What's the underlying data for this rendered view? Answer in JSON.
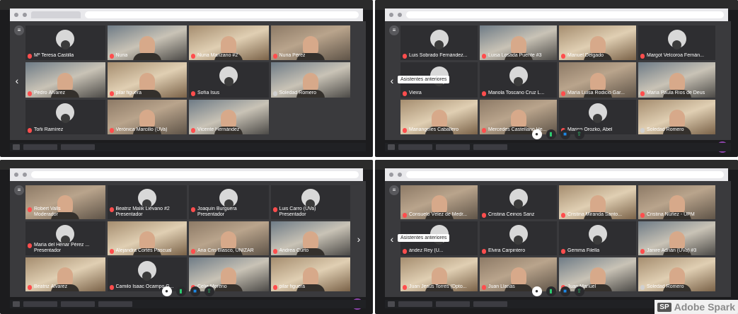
{
  "panels": [
    {
      "tiles": [
        {
          "name": "Mª Teresa Castilla",
          "muted": true,
          "camera": false
        },
        {
          "name": "Nuria",
          "muted": true,
          "camera": true
        },
        {
          "name": "Nuria Manzano #2",
          "muted": true,
          "camera": true
        },
        {
          "name": "Nuria Pérez",
          "muted": true,
          "camera": true
        },
        {
          "name": "Pedro Álvarez",
          "muted": true,
          "camera": true
        },
        {
          "name": "pilar figuera",
          "muted": true,
          "camera": true
        },
        {
          "name": "Sofía Isus",
          "muted": true,
          "camera": false
        },
        {
          "name": "Soledad Romero",
          "muted": false,
          "camera": true
        },
        {
          "name": "Toñi Ramírez",
          "muted": true,
          "camera": false
        },
        {
          "name": "Verónica Marcillo (UVa)",
          "muted": true,
          "camera": true
        },
        {
          "name": "Vicente Hernández",
          "muted": true,
          "camera": true
        }
      ]
    },
    {
      "tooltip": "Asistentes anteriores",
      "tiles": [
        {
          "name": "Luis Sobrado Fernández...",
          "muted": true,
          "camera": false
        },
        {
          "name": "Luisa Losada Puente #3",
          "muted": true,
          "camera": true
        },
        {
          "name": "Manuel Delgado",
          "muted": true,
          "camera": true
        },
        {
          "name": "Margot Velcoroa Fernán...",
          "muted": true,
          "camera": false
        },
        {
          "name": "Vieira",
          "muted": true,
          "camera": false
        },
        {
          "name": "Mariola Toscano Cruz L...",
          "muted": true,
          "camera": false
        },
        {
          "name": "María Luisa Rodicio Gar...",
          "muted": true,
          "camera": true
        },
        {
          "name": "María Paula Ríos de Deus",
          "muted": true,
          "camera": true
        },
        {
          "name": "Mariangeles Caballero",
          "muted": true,
          "camera": true
        },
        {
          "name": "Mercedes Castellano He...",
          "muted": true,
          "camera": true
        },
        {
          "name": "Marino Orozko, Abel",
          "muted": true,
          "camera": false
        },
        {
          "name": "Soledad Romero",
          "muted": false,
          "camera": true
        }
      ]
    },
    {
      "tiles": [
        {
          "name": "Robert Valls",
          "role": "Moderador",
          "muted": true,
          "camera": true
        },
        {
          "name": "Beatriz Malik Liévano #2",
          "role": "Presentador",
          "muted": true,
          "camera": false
        },
        {
          "name": "Joaquín Burguera",
          "role": "Presentador",
          "muted": true,
          "camera": false
        },
        {
          "name": "Luis Carro (UVa)",
          "role": "Presentador",
          "muted": true,
          "camera": false
        },
        {
          "name": "María del Henar Pérez ...",
          "role": "Presentador",
          "muted": true,
          "camera": false
        },
        {
          "name": "Alejandra Cortés Pascual",
          "muted": true,
          "camera": true
        },
        {
          "name": "Ana Cris Blasco, UNIZAR",
          "muted": true,
          "camera": true
        },
        {
          "name": "Andrea Curto",
          "muted": true,
          "camera": true
        },
        {
          "name": "Beatriz Álvarez",
          "muted": true,
          "camera": true
        },
        {
          "name": "Camilo Isaac Ocampo G...",
          "muted": true,
          "camera": false
        },
        {
          "name": "Celia Moreno",
          "muted": true,
          "camera": true
        },
        {
          "name": "pilar figuera",
          "muted": true,
          "camera": true
        }
      ]
    },
    {
      "tooltip": "Asistentes anteriores",
      "tiles": [
        {
          "name": "Consuelo Vélez de Medr...",
          "muted": true,
          "camera": true
        },
        {
          "name": "Cristina Ceinos Sanz",
          "muted": true,
          "camera": false
        },
        {
          "name": "Cristina Miranda Santo...",
          "muted": true,
          "camera": true
        },
        {
          "name": "Cristina Núñez - UPM",
          "muted": true,
          "camera": true
        },
        {
          "name": "ández Rey (U...",
          "muted": true,
          "camera": false
        },
        {
          "name": "Elvira Carpintero",
          "muted": true,
          "camera": false
        },
        {
          "name": "Gemma Filella",
          "muted": true,
          "camera": false
        },
        {
          "name": "Janire Adrián (UVa) #3",
          "muted": true,
          "camera": true
        },
        {
          "name": "Juan Jesús Torres (Dpto...",
          "muted": true,
          "camera": true
        },
        {
          "name": "Juan Llanas",
          "muted": true,
          "camera": true
        },
        {
          "name": "Juan Manuel",
          "muted": true,
          "camera": true
        },
        {
          "name": "Soledad Romero",
          "muted": false,
          "camera": true
        }
      ]
    }
  ],
  "watermark": {
    "badge": "SP",
    "text": "Adobe Spark"
  },
  "icons": {
    "menu": "menu-icon",
    "left_arrow": "chevron-left-icon",
    "right_arrow": "chevron-right-icon",
    "mic": "mic-icon",
    "video": "video-icon",
    "share": "share-screen-icon",
    "user": "user-avatar-icon"
  },
  "colors": {
    "muted_mic": "#ff4d4d",
    "stage": "#3a3a3d",
    "accent": "#8e44ad"
  }
}
